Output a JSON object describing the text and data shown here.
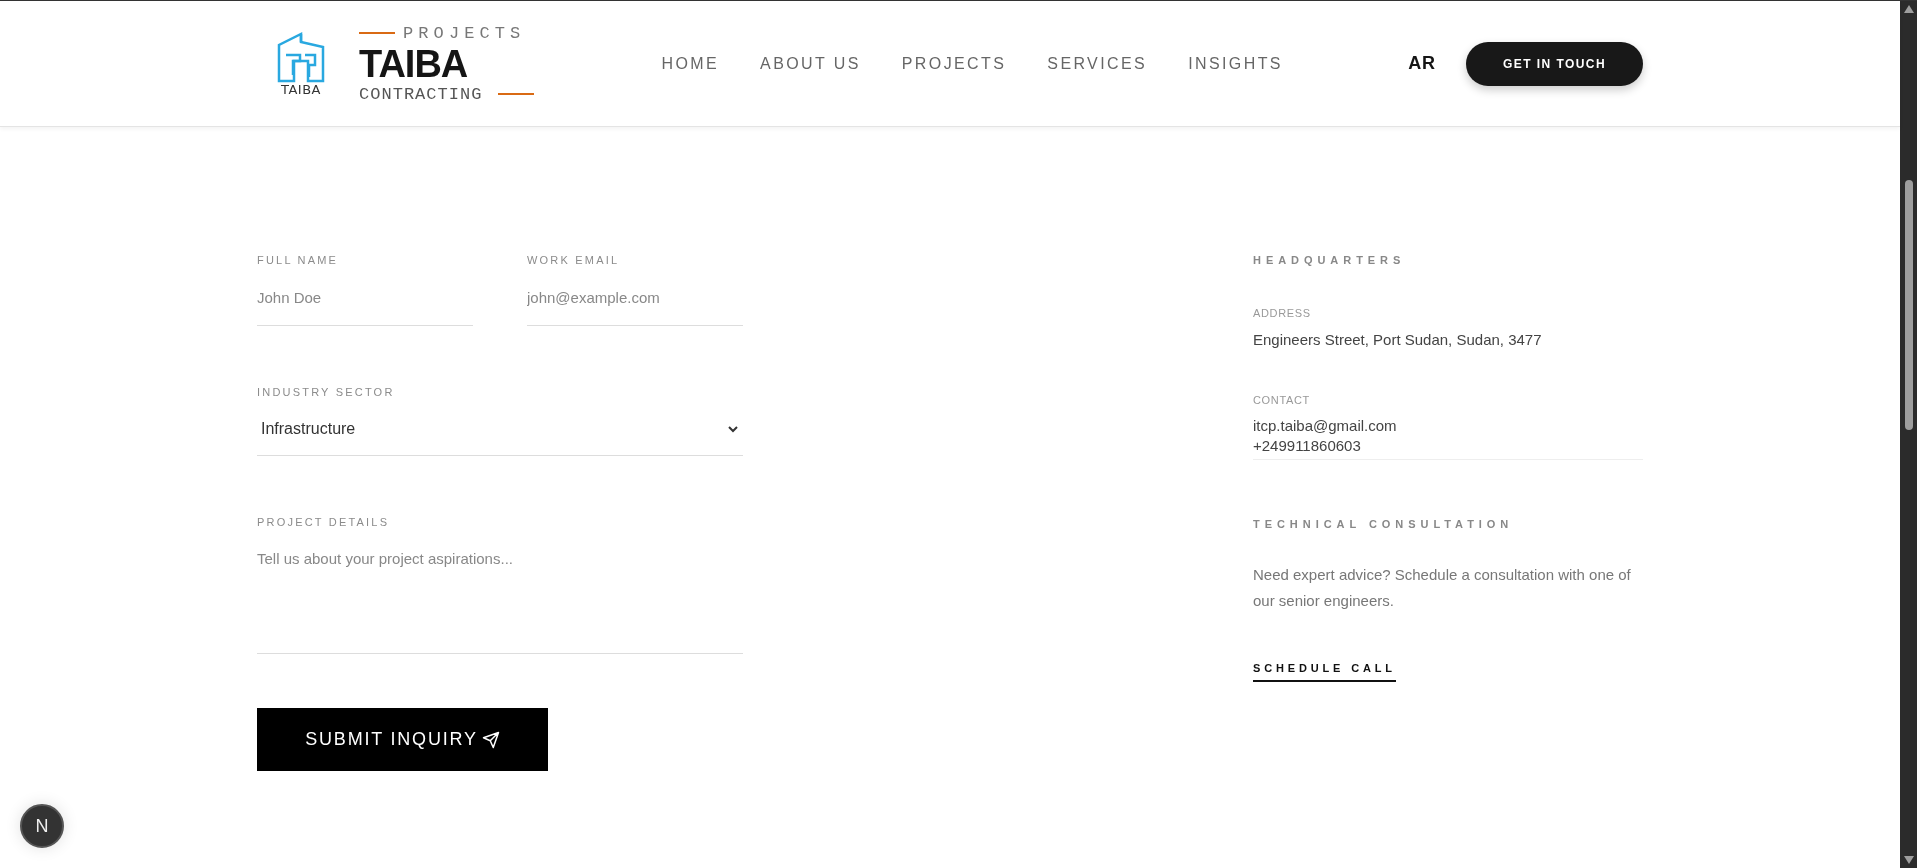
{
  "header": {
    "logo": {
      "mark_text": "TAIBA",
      "top_word": "PROJECTS",
      "name": "TAIBA",
      "bottom_word": "CONTRACTING"
    },
    "nav": [
      {
        "label": "HOME"
      },
      {
        "label": "ABOUT US"
      },
      {
        "label": "PROJECTS"
      },
      {
        "label": "SERVICES"
      },
      {
        "label": "INSIGHTS"
      }
    ],
    "language": "AR",
    "cta": "GET IN TOUCH"
  },
  "form": {
    "fields": [
      {
        "kind": "input",
        "label": "FULL NAME",
        "placeholder": "John Doe"
      },
      {
        "kind": "input",
        "label": "WORK EMAIL",
        "placeholder": "john@example.com"
      },
      {
        "kind": "select",
        "label": "INDUSTRY SECTOR",
        "value": "Infrastructure"
      },
      {
        "kind": "textarea",
        "label": "PROJECT DETAILS",
        "placeholder": "Tell us about your project aspirations..."
      }
    ],
    "submit": "SUBMIT INQUIRY"
  },
  "info": {
    "title": "HEADQUARTERS",
    "blocks": [
      {
        "label": "ADDRESS",
        "lines": [
          "Engineers Street, Port Sudan, Sudan, 3477"
        ]
      },
      {
        "label": "CONTACT",
        "lines": [
          "itcp.taiba@gmail.com",
          "+249911860603"
        ]
      }
    ],
    "consultation": {
      "title": "TECHNICAL CONSULTATION",
      "text": "Need expert advice? Schedule a consultation with one of our senior engineers.",
      "link": "SCHEDULE CALL"
    }
  },
  "dev_badge": "N"
}
